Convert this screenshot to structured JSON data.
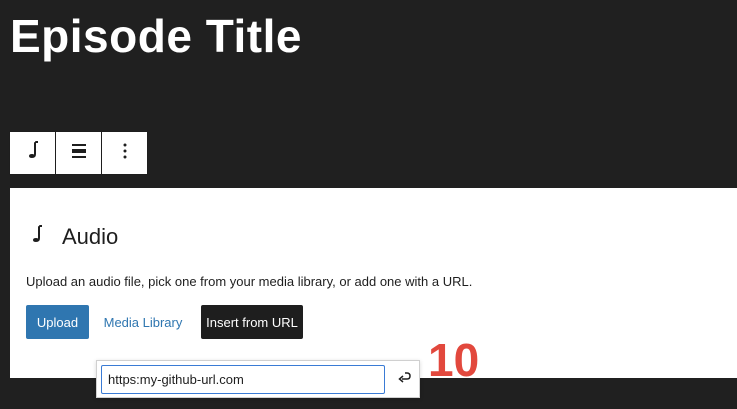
{
  "header": {
    "title": "Episode Title"
  },
  "toolbar": {
    "items": [
      {
        "icon": "music-note-icon"
      },
      {
        "icon": "align-icon"
      },
      {
        "icon": "more-options-icon"
      }
    ]
  },
  "block": {
    "label": "Audio",
    "icon": "music-note-icon",
    "instructions": "Upload an audio file, pick one from your media library, or add one with a URL.",
    "buttons": {
      "upload": "Upload",
      "media_library": "Media Library",
      "insert_url": "Insert from URL"
    }
  },
  "url_popover": {
    "value": "https:my-github-url.com",
    "apply_icon": "enter-icon"
  },
  "annotation": {
    "step": "10"
  },
  "colors": {
    "background": "#202020",
    "accent": "#2f76b0",
    "annotation": "#e2483d"
  }
}
